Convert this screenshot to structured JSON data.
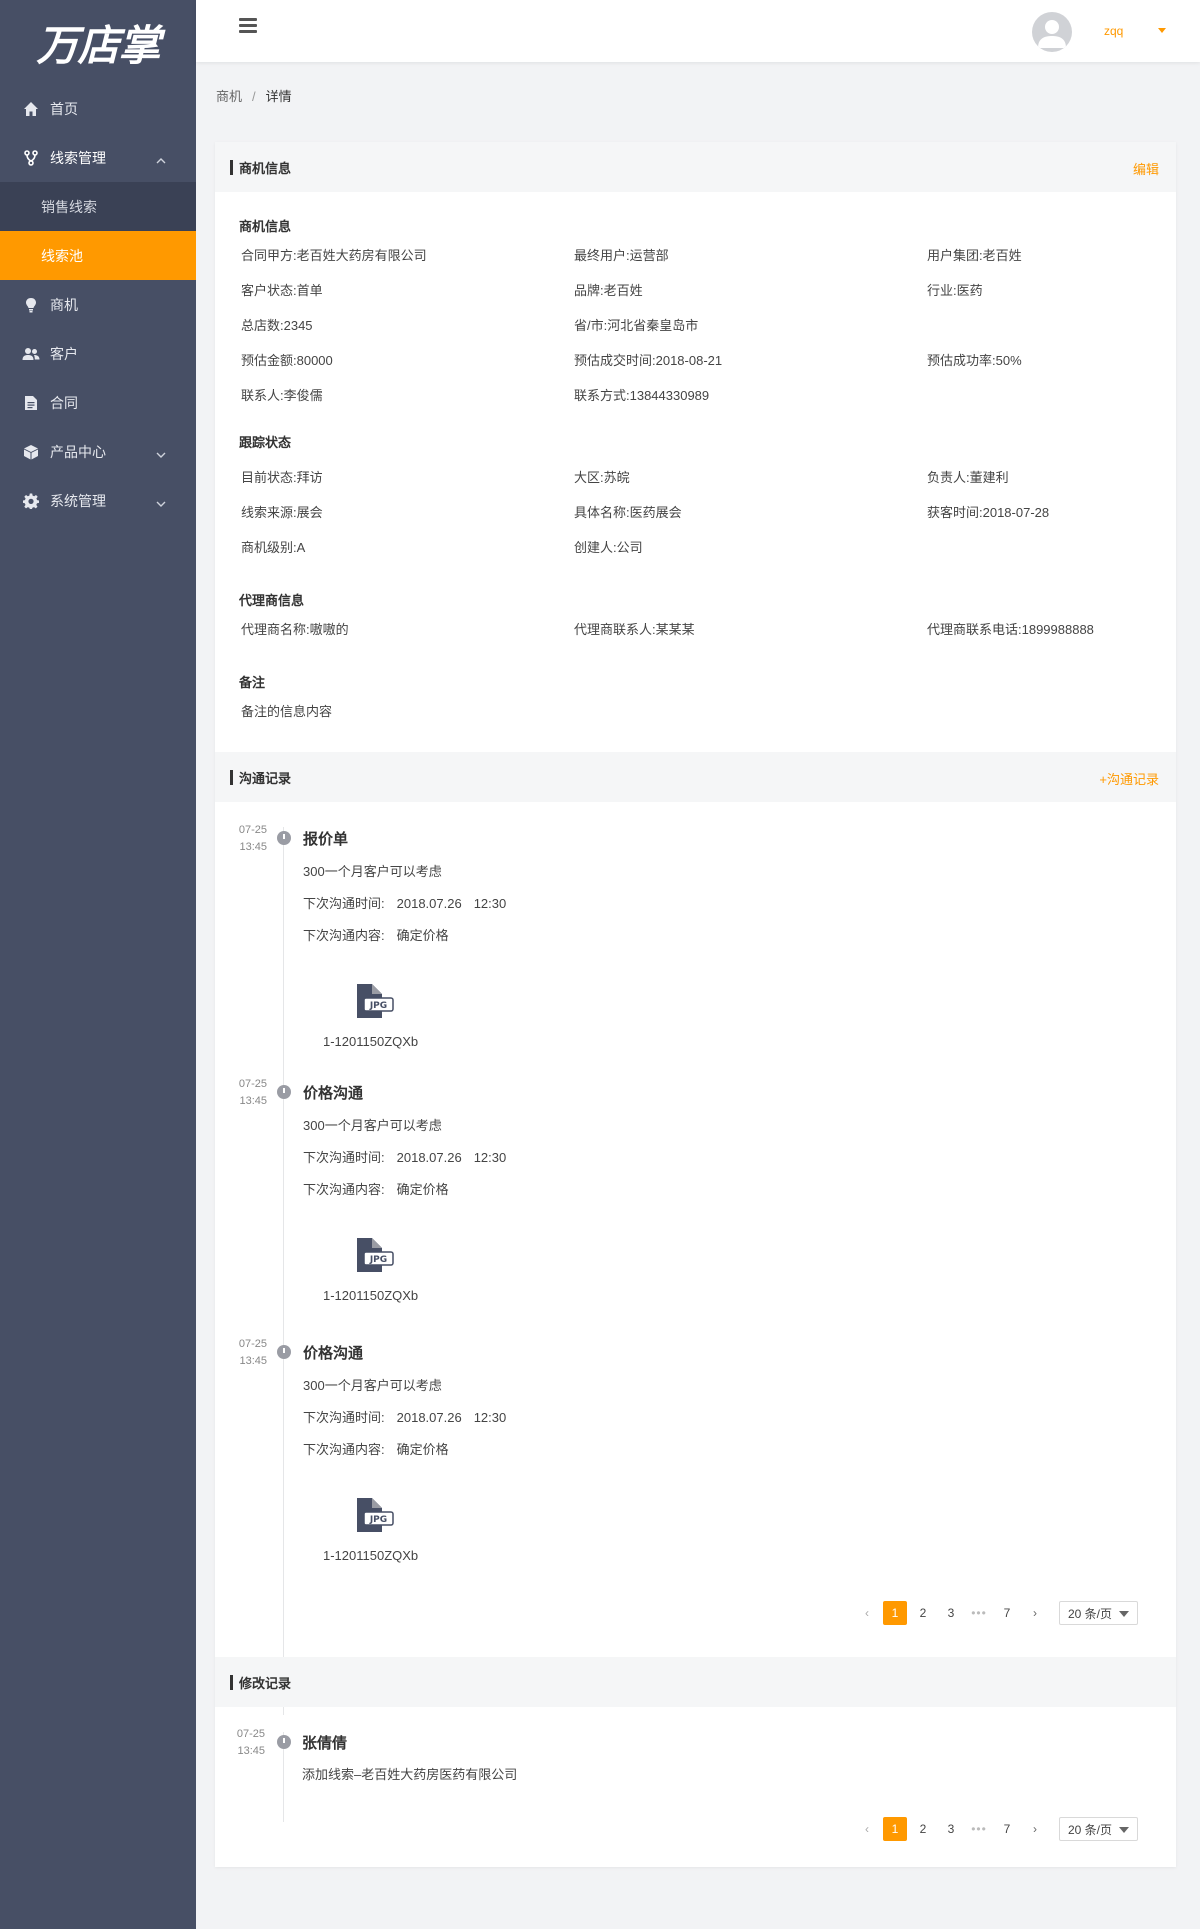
{
  "app": {
    "logo_text": "万店掌"
  },
  "sidebar": {
    "items": [
      {
        "label": "首页"
      },
      {
        "label": "线索管理"
      },
      {
        "label": "销售线索"
      },
      {
        "label": "线索池"
      },
      {
        "label": "商机"
      },
      {
        "label": "客户"
      },
      {
        "label": "合同"
      },
      {
        "label": "产品中心"
      },
      {
        "label": "系统管理"
      }
    ]
  },
  "header": {
    "username": "zqq"
  },
  "breadcrumb": {
    "parent": "商机",
    "separator": "/",
    "current": "详情"
  },
  "opportunity": {
    "section_title": "商机信息",
    "edit_label": "编辑",
    "basic": {
      "title": "商机信息",
      "fields": [
        "合同甲方:老百姓大药房有限公司",
        "最终用户:运营部",
        "用户集团:老百姓",
        "客户状态:首单",
        "品牌:老百姓",
        "行业:医药",
        "总店数:2345",
        "省/市:河北省秦皇岛市",
        "预估金额:80000",
        "预估成交时间:2018-08-21",
        "预估成功率:50%",
        "联系人:李俊儒",
        "联系方式:13844330989"
      ]
    },
    "tracking": {
      "title": "跟踪状态",
      "fields": [
        "目前状态:拜访",
        "大区:苏皖",
        "负责人:董建利",
        "线索来源:展会",
        "具体名称:医药展会",
        "获客时间:2018-07-28",
        "商机级别:A",
        "创建人:公司"
      ]
    },
    "agent": {
      "title": "代理商信息",
      "fields": [
        "代理商名称:嗷嗷的",
        "代理商联系人:某某某",
        "代理商联系电话:1899988888"
      ]
    },
    "remark": {
      "title": "备注",
      "text": "备注的信息内容"
    }
  },
  "communication": {
    "section_title": "沟通记录",
    "add_label": "+沟通记录",
    "records": [
      {
        "date": "07-25",
        "time": "13:45",
        "title": "报价单",
        "note": "300一个月客户可以考虑",
        "next_time_label": "下次沟通时间:",
        "next_date": "2018.07.26",
        "next_clock": "12:30",
        "next_content_label": "下次沟通内容:",
        "next_content": "确定价格",
        "file_icon": "jpg-file-icon",
        "file_badge": "JPG",
        "file_name": "1-1201150ZQXb"
      },
      {
        "date": "07-25",
        "time": "13:45",
        "title": "价格沟通",
        "note": "300一个月客户可以考虑",
        "next_time_label": "下次沟通时间:",
        "next_date": "2018.07.26",
        "next_clock": "12:30",
        "next_content_label": "下次沟通内容:",
        "next_content": "确定价格",
        "file_icon": "jpg-file-icon",
        "file_badge": "JPG",
        "file_name": "1-1201150ZQXb"
      },
      {
        "date": "07-25",
        "time": "13:45",
        "title": "价格沟通",
        "note": "300一个月客户可以考虑",
        "next_time_label": "下次沟通时间:",
        "next_date": "2018.07.26",
        "next_clock": "12:30",
        "next_content_label": "下次沟通内容:",
        "next_content": "确定价格",
        "file_icon": "jpg-file-icon",
        "file_badge": "JPG",
        "file_name": "1-1201150ZQXb"
      }
    ],
    "pagination": {
      "prev": "‹",
      "pages": [
        "1",
        "2",
        "3"
      ],
      "dots": "•••",
      "last": "7",
      "next": "›",
      "page_size": "20 条/页",
      "current": 1
    }
  },
  "modification": {
    "section_title": "修改记录",
    "records": [
      {
        "date": "07-25",
        "time": "13:45",
        "title": "张倩倩",
        "text": "添加线索–老百姓大药房医药有限公司"
      }
    ],
    "pagination": {
      "prev": "‹",
      "pages": [
        "1",
        "2",
        "3"
      ],
      "dots": "•••",
      "last": "7",
      "next": "›",
      "page_size": "20 条/页",
      "current": 1
    }
  },
  "colors": {
    "accent": "#ff9900",
    "sidebar_bg": "#474f65",
    "sidebar_sub_bg": "#3a4155"
  }
}
